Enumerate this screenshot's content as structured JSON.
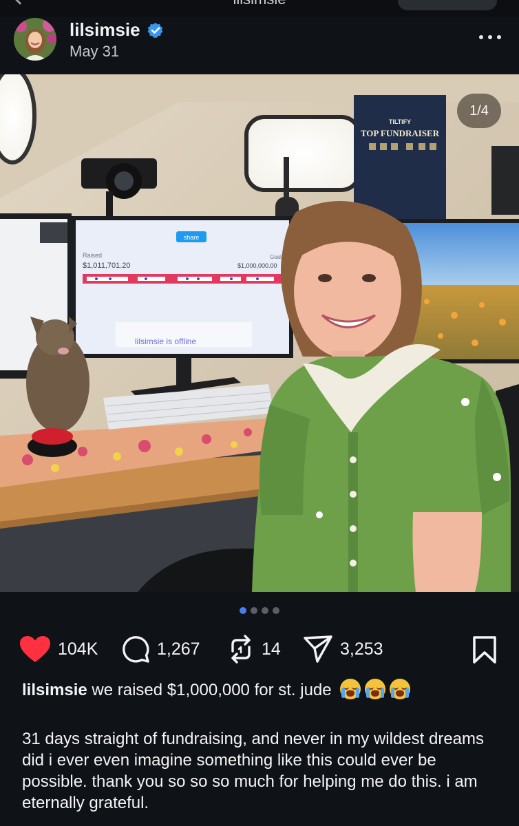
{
  "topbar": {
    "title": "lilsimsie"
  },
  "post": {
    "username": "lilsimsie",
    "date": "May 31",
    "page_counter": "1/4",
    "carousel": {
      "current": 1,
      "total": 4
    }
  },
  "photo_texts": {
    "share": "share",
    "raised_label": "Raised",
    "raised_amount": "$1,011,701.20",
    "goal_label": "Goal",
    "goal_amount": "$1,000,000.00",
    "offline": "lilsimsie is offline",
    "banner_brand": "TILTIFY",
    "banner_title": "TOP FUNDRAISER"
  },
  "actions": {
    "likes": "104K",
    "comments": "1,267",
    "reposts": "14",
    "shares": "3,253"
  },
  "caption": {
    "username": "lilsimsie",
    "text": "we raised $1,000,000 for st. jude",
    "body": "31 days straight of fundraising, and never in my wildest dreams did i ever even imagine something like this could ever be possible. thank you so so so much for helping me do this. i am eternally grateful."
  },
  "colors": {
    "background": "#0f1216",
    "like": "#ff3040",
    "verified": "#3797f0",
    "dot_active": "#4a7cf0"
  },
  "icons": [
    "heart-icon",
    "comment-icon",
    "repost-icon",
    "share-icon",
    "bookmark-icon",
    "verified-icon",
    "more-icon"
  ]
}
